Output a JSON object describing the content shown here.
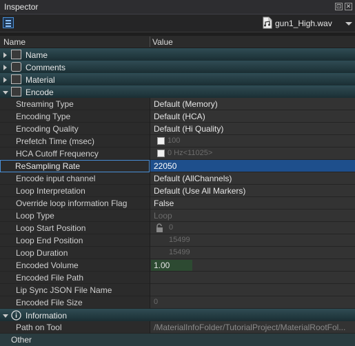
{
  "window": {
    "title": "Inspector",
    "btn_float": "⊡",
    "btn_close": "✕"
  },
  "toolbar": {
    "file_name": "gun1_High.wav",
    "file_icon": "document-audio-icon"
  },
  "columns": {
    "name": "Name",
    "value": "Value"
  },
  "categories": {
    "name": "Name",
    "comments": "Comments",
    "material": "Material",
    "encode": "Encode",
    "information": "Information",
    "other": "Other"
  },
  "encode": {
    "streaming_type": {
      "label": "Streaming Type",
      "value": "Default (Memory)"
    },
    "encoding_type": {
      "label": "Encoding Type",
      "value": "Default (HCA)"
    },
    "encoding_quality": {
      "label": "Encoding Quality",
      "value": "Default (Hi Quality)"
    },
    "prefetch_time": {
      "label": "Prefetch Time (msec)",
      "value": "100"
    },
    "hca_cutoff": {
      "label": "HCA Cutoff Frequency",
      "value": "0 Hz<11025>"
    },
    "resampling_rate": {
      "label": "ReSampling Rate",
      "value": "22050"
    },
    "encode_input_channel": {
      "label": "Encode input channel",
      "value": "Default (AllChannels)"
    },
    "loop_interpretation": {
      "label": "Loop Interpretation",
      "value": "Default (Use All Markers)"
    },
    "override_loop": {
      "label": "Override loop information Flag",
      "value": "False"
    },
    "loop_type": {
      "label": "Loop Type",
      "value": "Loop"
    },
    "loop_start": {
      "label": "Loop Start Position",
      "value": "0"
    },
    "loop_end": {
      "label": "Loop End Position",
      "value": "15499"
    },
    "loop_duration": {
      "label": "Loop Duration",
      "value": "15499"
    },
    "encoded_volume": {
      "label": "Encoded Volume",
      "value": "1.00"
    },
    "encoded_file_path": {
      "label": "Encoded File Path",
      "value": ""
    },
    "lip_sync": {
      "label": "Lip Sync JSON File Name",
      "value": ""
    },
    "encoded_file_size": {
      "label": "Encoded File Size",
      "value": "0"
    }
  },
  "information": {
    "path_on_tool": {
      "label": "Path on Tool",
      "value": "/MaterialInfoFolder/TutorialProject/MaterialRootFol..."
    }
  }
}
